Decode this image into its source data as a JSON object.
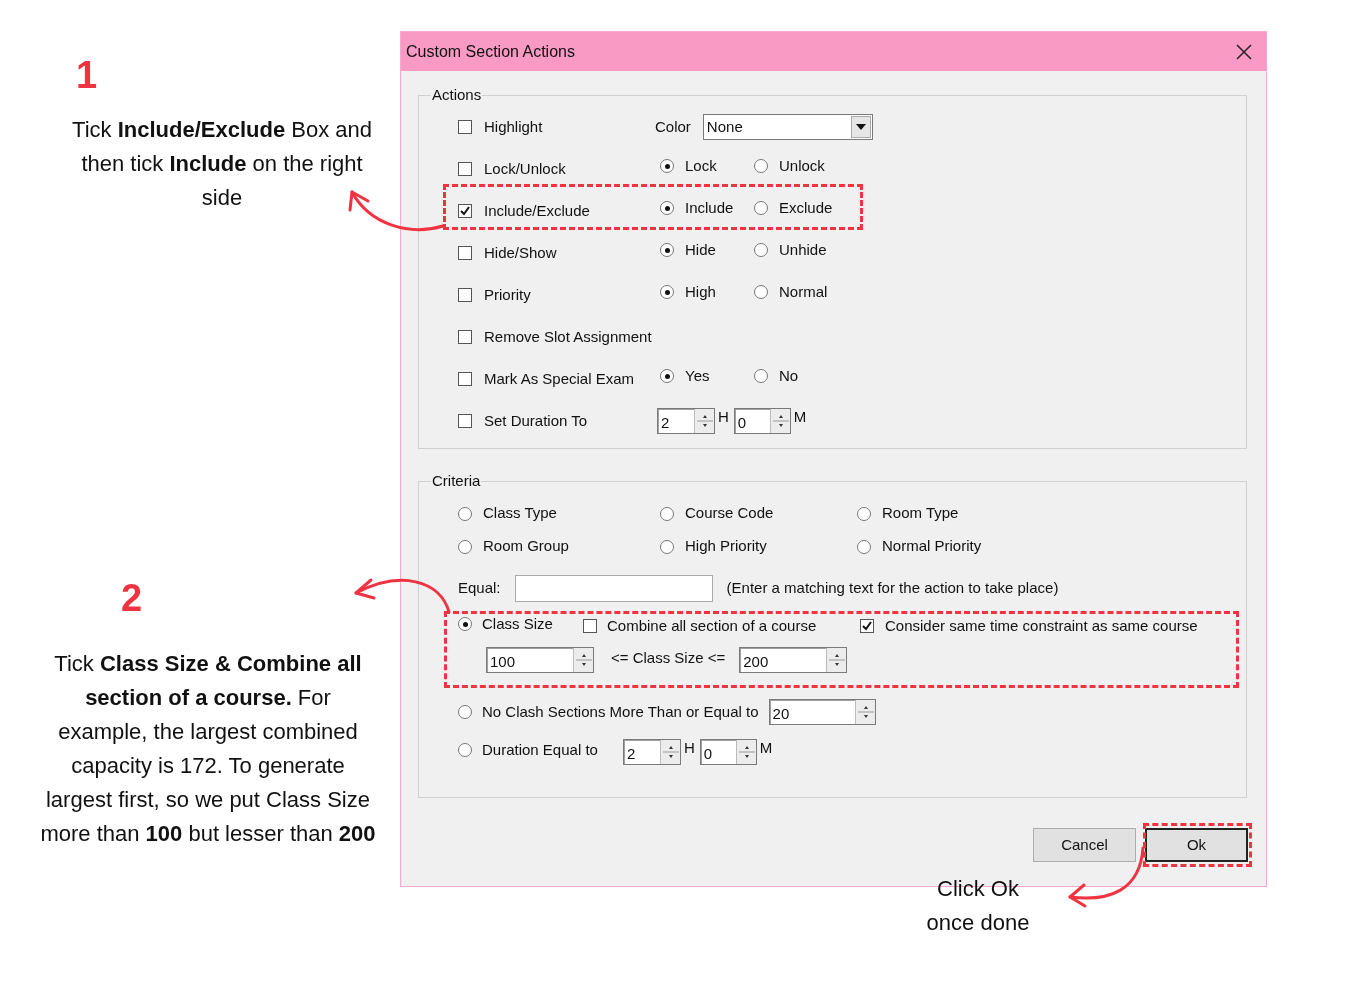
{
  "dialog": {
    "title": "Custom Section Actions",
    "actions": {
      "legend": "Actions",
      "rows": [
        {
          "kind": "color",
          "label": "Highlight",
          "checked": false,
          "color_label": "Color",
          "value": "None"
        },
        {
          "kind": "choice",
          "label": "Lock/Unlock",
          "checked": false,
          "options": [
            {
              "label": "Lock",
              "selected": true
            },
            {
              "label": "Unlock",
              "selected": false
            }
          ]
        },
        {
          "kind": "choice",
          "label": "Include/Exclude",
          "checked": true,
          "options": [
            {
              "label": "Include",
              "selected": true
            },
            {
              "label": "Exclude",
              "selected": false
            }
          ]
        },
        {
          "kind": "choice",
          "label": "Hide/Show",
          "checked": false,
          "options": [
            {
              "label": "Hide",
              "selected": true
            },
            {
              "label": "Unhide",
              "selected": false
            }
          ]
        },
        {
          "kind": "choice",
          "label": "Priority",
          "checked": false,
          "options": [
            {
              "label": "High",
              "selected": true
            },
            {
              "label": "Normal",
              "selected": false
            }
          ]
        },
        {
          "kind": "plain",
          "label": "Remove Slot Assignment",
          "checked": false
        },
        {
          "kind": "choice",
          "label": "Mark As Special Exam",
          "checked": false,
          "options": [
            {
              "label": "Yes",
              "selected": true
            },
            {
              "label": "No",
              "selected": false
            }
          ]
        },
        {
          "kind": "duration",
          "label": "Set Duration To",
          "checked": false,
          "hours": "2",
          "hours_unit": "H",
          "minutes": "0",
          "minutes_unit": "M"
        }
      ]
    },
    "criteria": {
      "legend": "Criteria",
      "options": [
        {
          "label": "Class Type",
          "selected": false
        },
        {
          "label": "Course Code",
          "selected": false
        },
        {
          "label": "Room Type",
          "selected": false
        },
        {
          "label": "Room Group",
          "selected": false
        },
        {
          "label": "High Priority",
          "selected": false
        },
        {
          "label": "Normal Priority",
          "selected": false
        }
      ],
      "equal": {
        "label": "Equal:",
        "hint": "(Enter a matching text for the action to take place)"
      },
      "class_size": {
        "label": "Class Size",
        "selected": true,
        "combine": {
          "label": "Combine all section of a course",
          "checked": false
        },
        "consider": {
          "label": "Consider same time constraint as same course",
          "checked": true
        },
        "min": "100",
        "range_label": "<= Class Size <=",
        "max": "200"
      },
      "no_clash": {
        "label": "No Clash Sections More Than or Equal to",
        "selected": false,
        "value": "20"
      },
      "duration": {
        "label": "Duration Equal to",
        "selected": false,
        "hours": "2",
        "hours_unit": "H",
        "minutes": "0",
        "minutes_unit": "M"
      }
    },
    "buttons": [
      {
        "label": "Cancel",
        "default": false
      },
      {
        "label": "Ok",
        "default": true
      }
    ]
  },
  "annotations": [
    {
      "number": "1",
      "text": "Tick **Include/Exclude** Box and then tick **Include** on the right side"
    },
    {
      "number": "2",
      "text": "Tick **Class Size & Combine all section of a course.** For example, the largest combined capacity is 172. To generate largest first, so we put Class Size more than **100** but lesser than **200**"
    },
    {
      "text": "Click Ok once done"
    }
  ]
}
